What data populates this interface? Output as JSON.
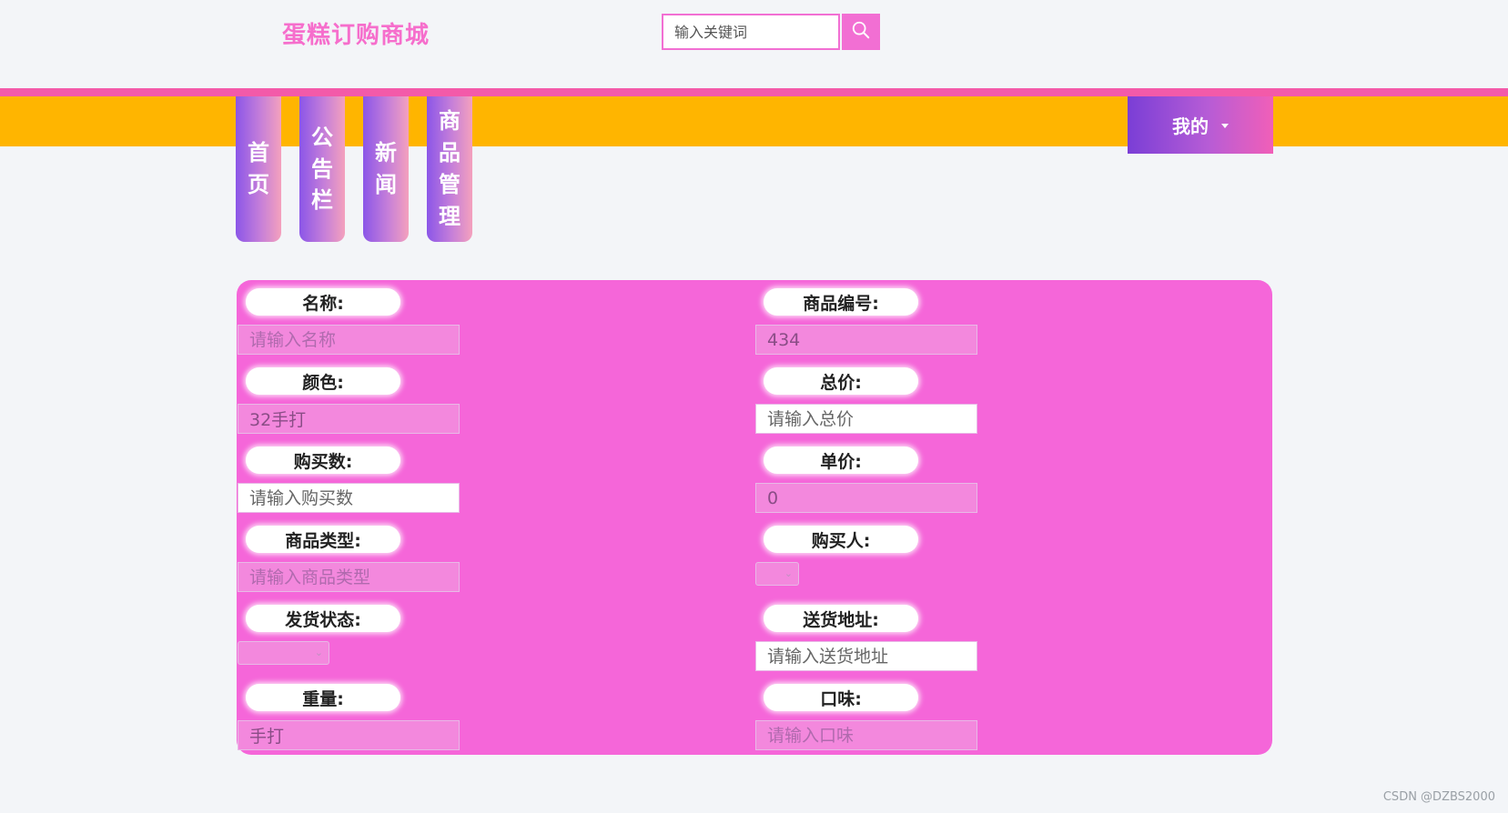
{
  "header": {
    "brand": "蛋糕订购商城",
    "search_placeholder": "输入关键词"
  },
  "nav": {
    "items": [
      {
        "label": "首页"
      },
      {
        "label": "公告栏"
      },
      {
        "label": "新闻"
      },
      {
        "label": "商品管理"
      }
    ],
    "my_menu": "我的"
  },
  "form": {
    "name": {
      "label": "名称:",
      "placeholder": "请输入名称",
      "value": ""
    },
    "product_no": {
      "label": "商品编号:",
      "placeholder": "",
      "value": "434"
    },
    "color": {
      "label": "颜色:",
      "placeholder": "",
      "value": "32手打"
    },
    "total_price": {
      "label": "总价:",
      "placeholder": "请输入总价",
      "value": ""
    },
    "quantity": {
      "label": "购买数:",
      "placeholder": "请输入购买数",
      "value": ""
    },
    "unit_price": {
      "label": "单价:",
      "placeholder": "",
      "value": "0"
    },
    "product_type": {
      "label": "商品类型:",
      "placeholder": "请输入商品类型",
      "value": ""
    },
    "buyer": {
      "label": "购买人:",
      "value": ""
    },
    "ship_status": {
      "label": "发货状态:",
      "value": ""
    },
    "address": {
      "label": "送货地址:",
      "placeholder": "请输入送货地址",
      "value": ""
    },
    "weight": {
      "label": "重量:",
      "placeholder": "",
      "value": "手打"
    },
    "flavor": {
      "label": "口味:",
      "placeholder": "请输入口味",
      "value": ""
    }
  },
  "footer": {
    "watermark": "CSDN @DZBS2000"
  },
  "colors": {
    "brand": "#f66ecc",
    "accent_line": "#f35aa9",
    "nav_bar": "#ffb500",
    "card": "#f566d9"
  }
}
